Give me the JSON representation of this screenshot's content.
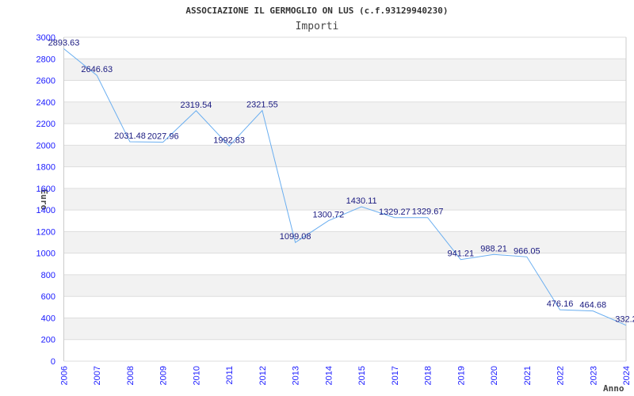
{
  "chart_data": {
    "type": "line",
    "title": "ASSOCIAZIONE IL GERMOGLIO ON LUS (c.f.93129940230)",
    "subtitle": "Importi",
    "xlabel": "Anno",
    "ylabel": "Euro",
    "ylim": [
      0,
      3000
    ],
    "yticks": [
      0,
      200,
      400,
      600,
      800,
      1000,
      1200,
      1400,
      1600,
      1800,
      2000,
      2200,
      2400,
      2600,
      2800,
      3000
    ],
    "grid": true,
    "categories": [
      "2006",
      "2007",
      "2008",
      "2009",
      "2010",
      "2011",
      "2012",
      "2013",
      "2014",
      "2015",
      "2017",
      "2018",
      "2019",
      "2020",
      "2021",
      "2022",
      "2023",
      "2024"
    ],
    "values": [
      2893.63,
      2646.63,
      2031.48,
      2027.96,
      2319.54,
      1992.83,
      2321.55,
      1099.08,
      1300.72,
      1430.11,
      1329.27,
      1329.67,
      941.21,
      988.21,
      966.05,
      476.16,
      464.68,
      332.2
    ],
    "data_labels": [
      "2893.63",
      "2646.63",
      "2031.48",
      "2027.96",
      "2319.54",
      "1992.83",
      "2321.55",
      "1099.08",
      "1300.72",
      "1430.11",
      "1329.27",
      "1329.67",
      "941.21",
      "988.21",
      "966.05",
      "476.16",
      "464.68",
      "332.2"
    ],
    "colors": {
      "line": "#6aaef0",
      "band": "#f2f2f2",
      "grid": "#dddddd",
      "tick": "#1a1aff",
      "data_label": "#1a1a80"
    }
  }
}
